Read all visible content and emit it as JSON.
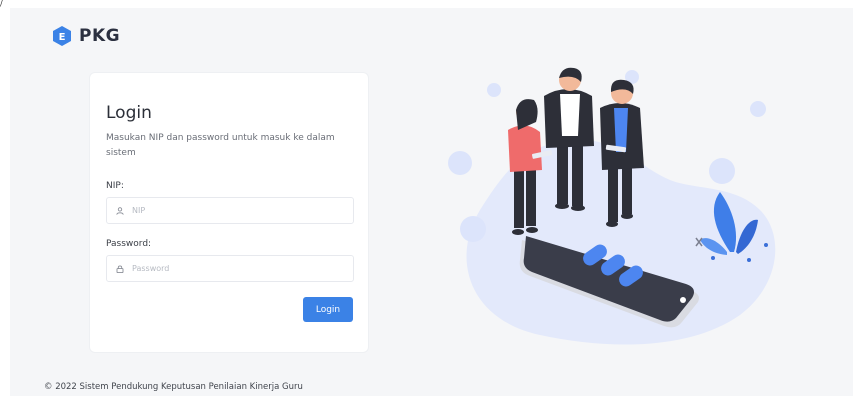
{
  "brand": {
    "name": "PKG",
    "logo_letter": "E",
    "logo_color": "#3b82e6"
  },
  "login": {
    "title": "Login",
    "description": "Masukan NIP dan password untuk masuk ke dalam sistem",
    "nip_label": "NIP:",
    "nip_placeholder": "NIP",
    "nip_value": "",
    "password_label": "Password:",
    "password_placeholder": "Password",
    "password_value": "",
    "submit_label": "Login"
  },
  "footer": {
    "text": "© 2022 Sistem Pendukung Keputusan Penilaian Kinerja Guru"
  },
  "colors": {
    "accent": "#3b82e6",
    "background": "#f5f6f8",
    "illustration_blob": "#e3e9fb"
  },
  "icons": {
    "nip": "user-icon",
    "password": "lock-icon"
  }
}
